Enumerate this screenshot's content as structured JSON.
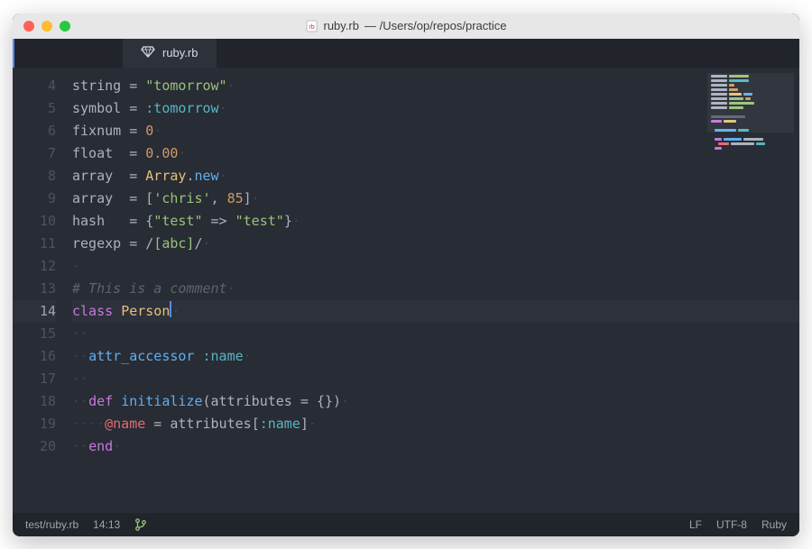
{
  "window": {
    "title_filename": "ruby.rb",
    "title_path": " — /Users/op/repos/practice"
  },
  "tab": {
    "filename": "ruby.rb"
  },
  "editor": {
    "first_line_number": 4,
    "active_line_number": 14,
    "cursor": {
      "line": 14,
      "col": 13
    },
    "lines": {
      "l4": {
        "var": "string",
        "op": " = ",
        "str": "\"tomorrow\""
      },
      "l5": {
        "var": "symbol",
        "op": " = ",
        "sym": ":tomorrow"
      },
      "l6": {
        "var": "fixnum",
        "op": " = ",
        "num": "0"
      },
      "l7": {
        "var": "float ",
        "op": " = ",
        "num": "0.00"
      },
      "l8": {
        "var": "array ",
        "op": " = ",
        "const": "Array",
        "dot": ".",
        "method": "new"
      },
      "l9": {
        "var": "array ",
        "op": " = ",
        "open": "[",
        "str": "'chris'",
        "comma": ", ",
        "num": "85",
        "close": "]"
      },
      "l10": {
        "var": "hash  ",
        "op": " = ",
        "open": "{",
        "key": "\"test\"",
        "arrow": " => ",
        "val": "\"test\"",
        "close": "}"
      },
      "l11": {
        "var": "regexp",
        "op": " = ",
        "slash1": "/",
        "body": "[abc]",
        "slash2": "/"
      },
      "l12": {
        "empty": true
      },
      "l13": {
        "cmt": "# This is a comment"
      },
      "l14": {
        "kw": "class",
        "sp": " ",
        "class": "Person"
      },
      "l15": {
        "indent": "  ",
        "empty": true
      },
      "l16": {
        "indent": "  ",
        "method": "attr_accessor",
        "sp": " ",
        "sym": ":name"
      },
      "l17": {
        "indent": "  ",
        "empty": true
      },
      "l18": {
        "indent": "  ",
        "kw": "def",
        "sp": " ",
        "method": "initialize",
        "open": "(",
        "param": "attributes",
        "eq": " = ",
        "braces": "{}",
        "close": ")"
      },
      "l19": {
        "indent": "    ",
        "ivar": "@name",
        "eq": " = ",
        "var": "attributes",
        "open": "[",
        "sym": ":name",
        "close": "]"
      },
      "l20": {
        "indent": "  ",
        "kw": "end"
      }
    }
  },
  "status": {
    "path": "test/ruby.rb",
    "cursor": "14:13",
    "line_ending": "LF",
    "encoding": "UTF-8",
    "grammar": "Ruby"
  }
}
